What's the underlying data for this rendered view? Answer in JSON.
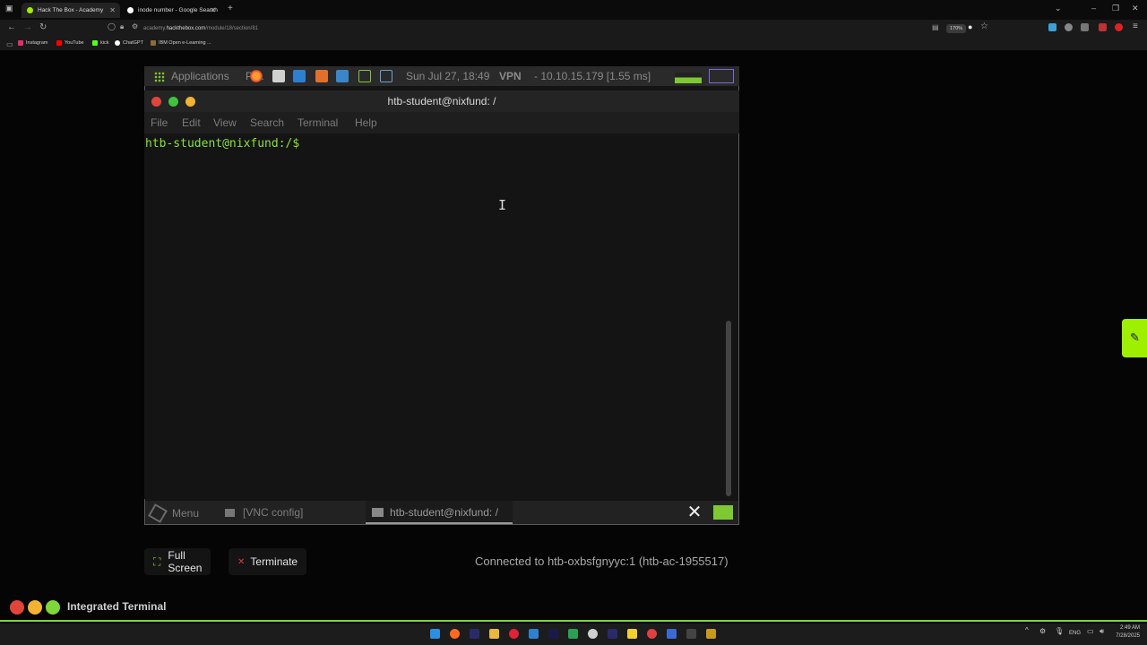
{
  "browser": {
    "tabs": [
      {
        "title": "Hack The Box - Academy",
        "active": true,
        "favicon_color": "#9fef00"
      },
      {
        "title": "inode number - Google Search",
        "active": false,
        "favicon_color": "#ffffff"
      }
    ],
    "new_tab_label": "+",
    "url_prefix": "academy.",
    "url_domain": "hackthebox.com",
    "url_path": "/module/18/section/81",
    "zoom": "170%",
    "bookmarks": [
      {
        "label": "Instagram",
        "color": "#e1306c"
      },
      {
        "label": "YouTube",
        "color": "#ff0000"
      },
      {
        "label": "kick",
        "color": "#53fc18"
      },
      {
        "label": "ChatGPT",
        "color": "#ffffff"
      },
      {
        "label": "IBM Open e-Learning ...",
        "color": "#8a6d3b"
      }
    ]
  },
  "vnc": {
    "panel": {
      "applications_label": "Applications",
      "places_fragment": "Pl...",
      "clock": "Sun Jul 27, 18:49",
      "vpn": "VPN",
      "vpn_info": "- 10.10.15.179 [1.55 ms]"
    },
    "terminal": {
      "title": "htb-student@nixfund: /",
      "menu": [
        "File",
        "Edit",
        "View",
        "Search",
        "Terminal",
        "Help"
      ],
      "prompt": "htb-student@nixfund:/$"
    },
    "taskbar": {
      "menu_label": "Menu",
      "vnc_config_label": "[VNC config]",
      "active_window_label": "htb-student@nixfund: /"
    }
  },
  "controls": {
    "fullscreen_label": "Full Screen",
    "terminate_label": "Terminate",
    "connection_status": "Connected to htb-oxbsfgnyyc:1 (htb-ac-1955517)"
  },
  "integrated_terminal": {
    "label": "Integrated Terminal",
    "dot_colors": [
      "#e0453a",
      "#f2b233",
      "#7fd63a"
    ]
  },
  "windows_taskbar": {
    "language": "ENG",
    "time": "2:49 AM",
    "date": "7/28/2025"
  },
  "colors": {
    "htb_green": "#9fef00",
    "prompt_green": "#8ae234"
  }
}
